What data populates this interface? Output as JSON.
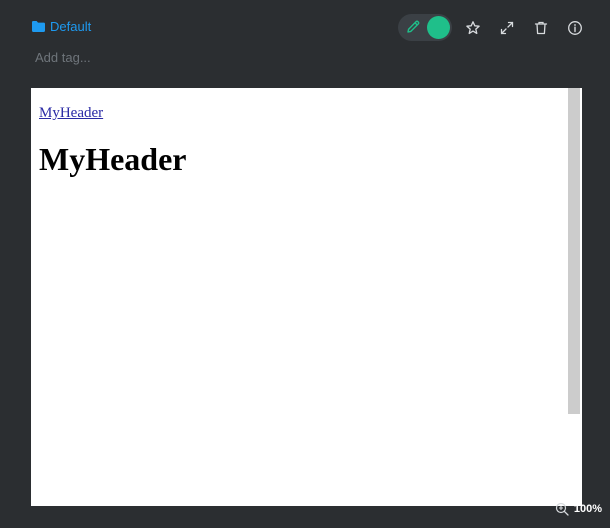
{
  "header": {
    "folder_label": "Default",
    "tag_placeholder": "Add tag..."
  },
  "toolbar": {
    "mode_toggle": {
      "state": "edit"
    },
    "icons": [
      "pencil-icon",
      "star-icon",
      "expand-icon",
      "trash-icon",
      "info-icon"
    ]
  },
  "preview": {
    "link_text": "MyHeader",
    "heading_text": "MyHeader"
  },
  "zoom": {
    "level": "100%"
  },
  "colors": {
    "background": "#2b2e31",
    "accent_blue": "#1e9af0",
    "toggle_green": "#1fbf8a",
    "toggle_track": "#3b4045",
    "icon": "#d7dadd"
  }
}
